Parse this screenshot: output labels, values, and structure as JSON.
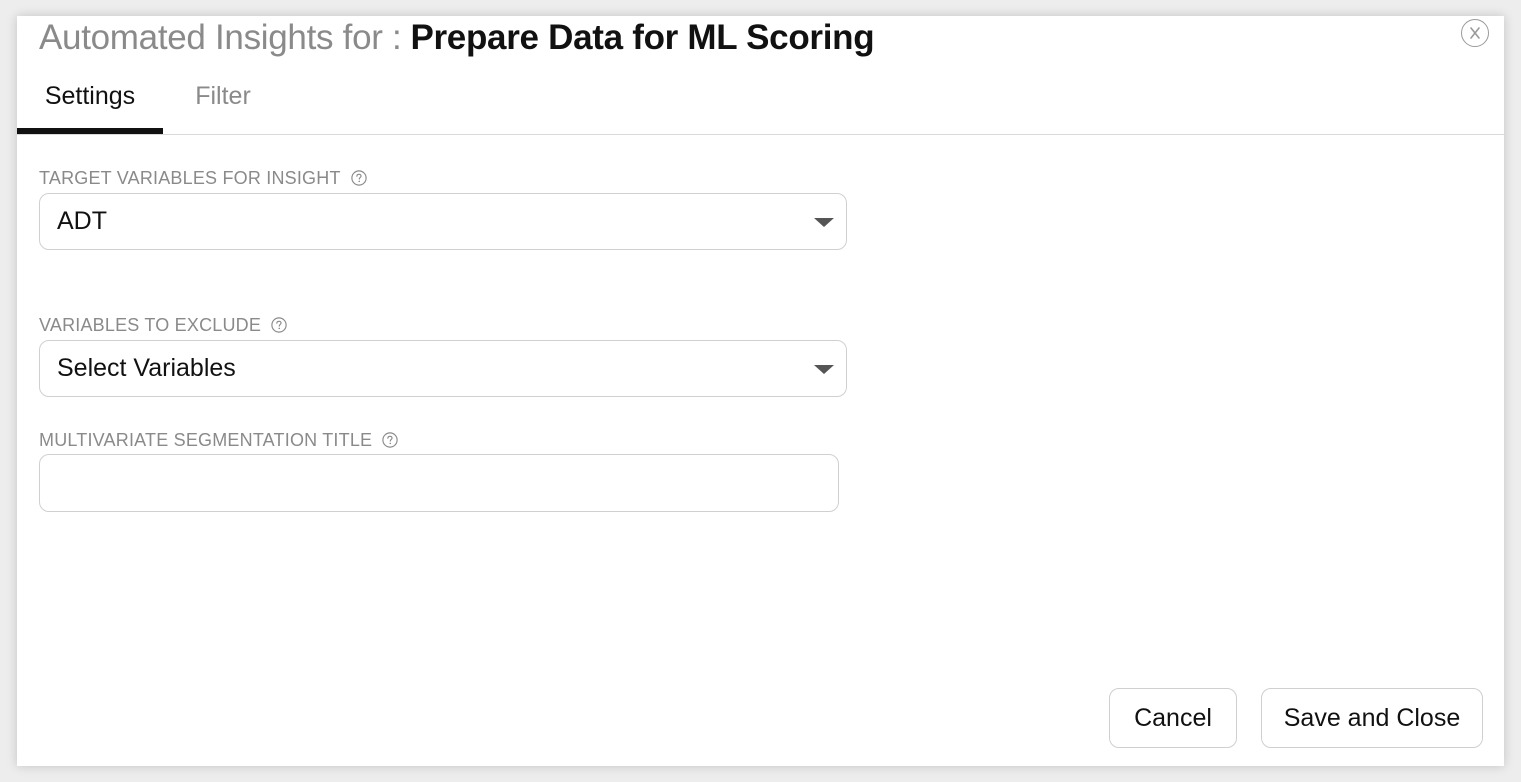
{
  "dialog": {
    "title_prefix": "Automated Insights for :",
    "title_main": "Prepare Data for ML Scoring",
    "close_icon": "close-circle-icon"
  },
  "tabs": [
    {
      "label": "Settings",
      "active": true
    },
    {
      "label": "Filter",
      "active": false
    }
  ],
  "fields": {
    "target": {
      "label": "TARGET VARIABLES FOR INSIGHT",
      "value": "ADT"
    },
    "exclude": {
      "label": "VARIABLES TO EXCLUDE",
      "value": "Select Variables"
    },
    "segmentation": {
      "label": "MULTIVARIATE SEGMENTATION TITLE",
      "value": "",
      "placeholder": ""
    }
  },
  "buttons": {
    "cancel": "Cancel",
    "save": "Save and Close"
  },
  "colors": {
    "active_tab_underline": "#111111",
    "muted_text": "#8a8a8a",
    "border": "#d0d0d0"
  }
}
